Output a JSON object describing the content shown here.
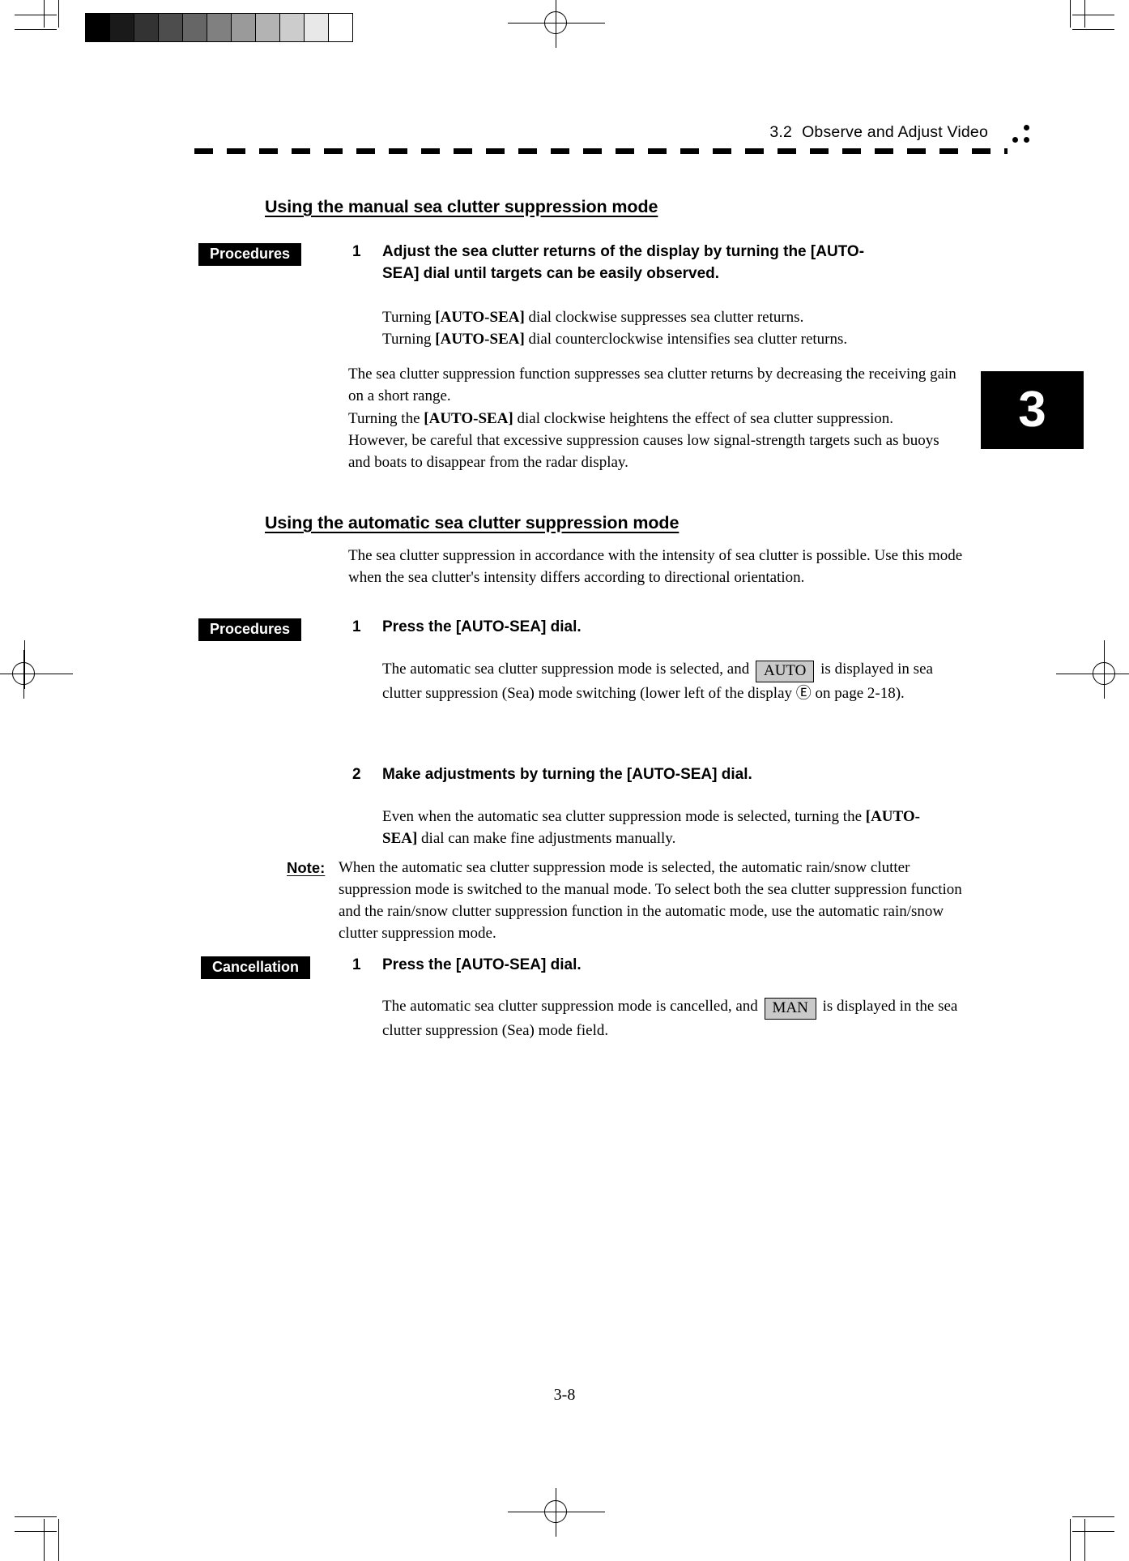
{
  "document": {
    "running_header": {
      "section_number": "3.2",
      "section_title": "Observe and Adjust Video"
    },
    "chapter_tab": "3",
    "page_number": "3-8"
  },
  "calibration_bar": {
    "name": "grayscale-step-wedge",
    "steps": [
      "#000000",
      "#1a1a1a",
      "#333333",
      "#4d4d4d",
      "#666666",
      "#808080",
      "#9a9a9a",
      "#b3b3b3",
      "#cccccc",
      "#e8e8e8",
      "#ffffff"
    ]
  },
  "sections": [
    {
      "id": "manual-mode",
      "heading": "Using the manual sea clutter suppression mode",
      "tag": "Procedures",
      "step_number": "1",
      "step_text": "Adjust the sea clutter returns of the display by turning the [AUTO-SEA] dial until targets can be easily observed.",
      "sub_lines": [
        {
          "prefix": "Turning ",
          "bold": "[AUTO-SEA]",
          "suffix": " dial clockwise suppresses sea clutter returns."
        },
        {
          "prefix": "Turning ",
          "bold": "[AUTO-SEA]",
          "suffix": " dial counterclockwise intensifies sea clutter returns."
        }
      ],
      "explanation": {
        "line1": "The sea clutter suppression function suppresses sea clutter returns by decreasing the receiving gain on a short range.",
        "line2_prefix": "Turning the ",
        "line2_bold": "[AUTO-SEA]",
        "line2_suffix": " dial clockwise heightens the effect of sea clutter suppression.",
        "line3": "However, be careful that excessive suppression causes low signal-strength targets such as buoys and boats to disappear from the radar display."
      }
    },
    {
      "id": "automatic-mode",
      "heading": "Using the automatic sea clutter suppression mode",
      "intro": "The sea clutter suppression in accordance with the intensity of sea clutter is possible.    Use this mode when the sea clutter's intensity differs according to directional orientation.",
      "tag": "Procedures",
      "steps": [
        {
          "number": "1",
          "text": "Press the [AUTO-SEA] dial.",
          "body_prefix": "The automatic sea clutter suppression mode is selected, and",
          "badge": "AUTO",
          "body_mid": "is displayed in sea clutter suppression (Sea) mode switching (lower left of the display",
          "circled_ref": "Ⓔ",
          "body_suffix": "on page 2-18)."
        },
        {
          "number": "2",
          "text": "Make adjustments by turning the [AUTO-SEA] dial.",
          "body_prefix": "Even when the automatic sea clutter suppression mode is selected, turning the",
          "body_bold": "[AUTO-SEA]",
          "body_suffix": "dial can make fine adjustments manually."
        }
      ],
      "note": {
        "label": "Note:",
        "line1": "When the automatic sea clutter suppression mode is selected, the automatic rain/snow clutter suppression mode is switched to the manual mode.",
        "line2": "To select both the sea clutter suppression function and the rain/snow clutter suppression function in the automatic mode, use the automatic rain/snow clutter suppression mode."
      }
    },
    {
      "id": "cancellation",
      "tag": "Cancellation",
      "step_number": "1",
      "step_text": "Press the [AUTO-SEA] dial.",
      "body_prefix": "The automatic sea clutter suppression mode is cancelled, and",
      "badge": "MAN",
      "body_suffix": "is displayed in the sea clutter suppression (Sea) mode field."
    }
  ],
  "colors": {
    "ink": "#000000",
    "paper": "#ffffff",
    "badge_fill": "#c9c9c9"
  }
}
